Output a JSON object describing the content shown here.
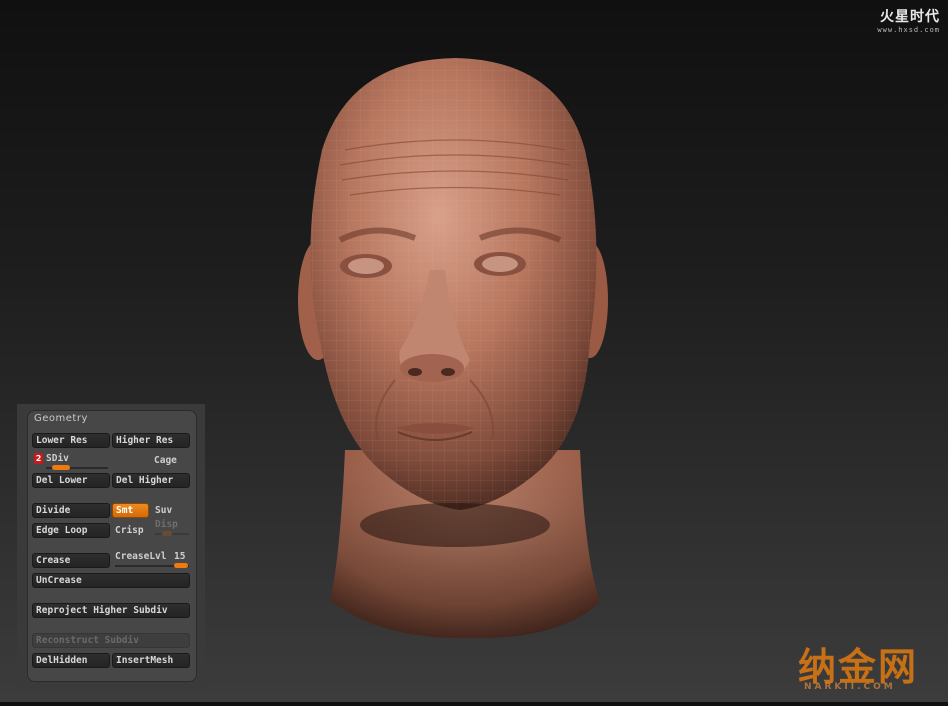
{
  "watermark_top": {
    "brand": "火星时代",
    "site": "www.hxsd.com"
  },
  "watermark_bottom": {
    "brand": "纳金网",
    "site": "NARKII.COM"
  },
  "geometry": {
    "title": "Geometry",
    "lower_res": "Lower Res",
    "higher_res": "Higher Res",
    "sdiv_value": "2",
    "sdiv_label": "SDiv",
    "cage": "Cage",
    "del_lower": "Del Lower",
    "del_higher": "Del Higher",
    "divide": "Divide",
    "smt": "Smt",
    "suv": "Suv",
    "edge_loop": "Edge Loop",
    "crisp": "Crisp",
    "disp": "Disp",
    "crease": "Crease",
    "crease_lvl_label": "CreaseLvl",
    "crease_lvl_value": "15",
    "uncrease": "UnCrease",
    "reproject": "Reproject Higher Subdiv",
    "reconstruct": "Reconstruct Subdiv",
    "del_hidden": "DelHidden",
    "insert_mesh": "InsertMesh"
  },
  "colors": {
    "accent": "#f07a10",
    "skin": "#b7765e",
    "panel": "#474747"
  }
}
